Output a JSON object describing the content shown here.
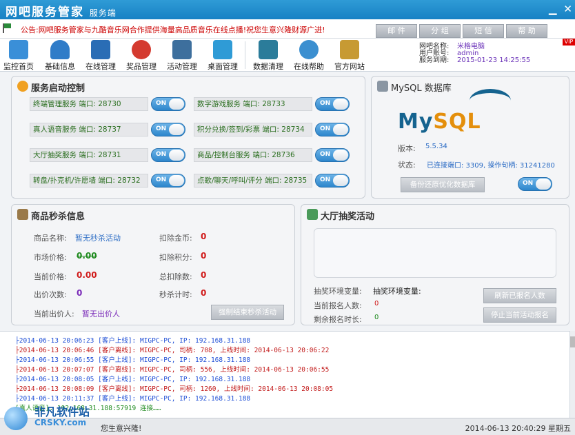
{
  "window": {
    "title": "网吧服务管家",
    "subtitle": "服务端",
    "min_icon": "minimize-icon",
    "close_icon": "close-icon"
  },
  "notice": {
    "text": "公告:网吧服务管家与九酷音乐网合作提供海量高品质音乐在线点播!祝您生意兴隆财源广进!"
  },
  "tabs": [
    "邮 件",
    "分 组",
    "短 信",
    "帮 助"
  ],
  "toolbar": [
    {
      "label": "监控首页",
      "icon": "home-icon",
      "color": "#3a8fd8"
    },
    {
      "label": "基础信息",
      "icon": "user-icon",
      "color": "#2f7cc8"
    },
    {
      "label": "在线管理",
      "icon": "network-icon",
      "color": "#2a6db5"
    },
    {
      "label": "奖品管理",
      "icon": "ball-icon",
      "color": "#d43a2f"
    },
    {
      "label": "活动管理",
      "icon": "book-icon",
      "color": "#3d6f9d"
    },
    {
      "label": "桌面管理",
      "icon": "chat-icon",
      "color": "#2f9bd6"
    },
    {
      "label": "数据清理",
      "icon": "bin-icon",
      "color": "#2b7c9a"
    },
    {
      "label": "在线帮助",
      "icon": "globe-icon",
      "color": "#3b8fd0"
    },
    {
      "label": "官方网站",
      "icon": "web-icon",
      "color": "#c79a33"
    }
  ],
  "netinfo": {
    "name_label": "网吧名称:",
    "name": "米格电脑",
    "account_label": "用户账号:",
    "account": "admin",
    "expire_label": "服务到期:",
    "expire": "2015-01-23 14:25:55"
  },
  "vip": "VIP",
  "services": {
    "title": "服务启动控制",
    "toggle_label": "ON",
    "left": [
      "终端管理服务 端口: 28730",
      "真人语音服务 端口: 28737",
      "大厅抽奖服务 端口: 28731",
      "转盘/扑克机/许愿墙 端口: 28732"
    ],
    "right": [
      "数字游戏服务 端口: 28733",
      "积分兑换/签到/彩票 端口: 28734",
      "商品/控制台服务 端口: 28736",
      "点歌/聊天/呼叫/评分 端口: 28735"
    ]
  },
  "mysql": {
    "title": "MySQL 数据库",
    "logo": "MySQL",
    "version_label": "版本:",
    "version": "5.5.34",
    "status_label": "状态:",
    "status": "已连接端口: 3309, 操作句柄: 31241280",
    "backup_label": "备份还原优化数据库",
    "toggle_label": "ON"
  },
  "seckill": {
    "title": "商品秒杀信息",
    "name_label": "商品名称:",
    "name": "暂无秒杀活动",
    "market_label": "市场价格:",
    "market": "0.00",
    "current_label": "当前价格:",
    "current": "0.00",
    "bids_label": "出价次数:",
    "bids": "0",
    "gold_label": "扣除金币:",
    "gold": "0",
    "points_label": "扣除积分:",
    "points": "0",
    "total_label": "总扣除数:",
    "total": "0",
    "timer_label": "秒杀计时:",
    "timer": "0",
    "bidder_label": "当前出价人:",
    "bidder": "暂无出价人",
    "end_label": "强制结束秒杀活动"
  },
  "lottery": {
    "title": "大厅抽奖活动",
    "env_label": "抽奖环境变量:",
    "env_value": "抽奖环境变量:",
    "count_label": "当前报名人数:",
    "count": "0",
    "remain_label": "剩余报名时长:",
    "remain": "0",
    "refresh_label": "刷新已报名人数",
    "stop_label": "停止当前活动报名"
  },
  "log": [
    {
      "text": "├2014-06-13 20:06:23 [客户上线]: MIGPC-PC, IP: 192.168.31.188",
      "color": "#1f4fd6"
    },
    {
      "text": "├2014-06-13 20:06:46 [客户离线]: MIGPC-PC, 司柄: 708, 上线时间: 2014-06-13 20:06:22",
      "color": "#c21a1a"
    },
    {
      "text": "├2014-06-13 20:06:55 [客户上线]: MIGPC-PC, IP: 192.168.31.188",
      "color": "#1f4fd6"
    },
    {
      "text": "├2014-06-13 20:07:07 [客户离线]: MIGPC-PC, 司柄: 556, 上线时间: 2014-06-13 20:06:55",
      "color": "#c21a1a"
    },
    {
      "text": "├2014-06-13 20:08:05 [客户上线]: MIGPC-PC, IP: 192.168.31.188",
      "color": "#1f4fd6"
    },
    {
      "text": "├2014-06-13 20:08:09 [客户离线]: MIGPC-PC, 司柄: 1260, 上线时间: 2014-06-13 20:08:05",
      "color": "#c21a1a"
    },
    {
      "text": "├2014-06-13 20:11:37 [客户上线]: MIGPC-PC, IP: 192.168.31.188",
      "color": "#1f4fd6"
    },
    {
      "text": "                        [真人语音]: 192.168.31.188:57919 连接……",
      "color": "#1e8a1e"
    }
  ],
  "status": {
    "message": "您生意兴隆!",
    "time": "2014-06-13 20:40:29 星期五"
  },
  "watermark": {
    "cn": "非凡软件站",
    "en": "CRSKY.com"
  }
}
